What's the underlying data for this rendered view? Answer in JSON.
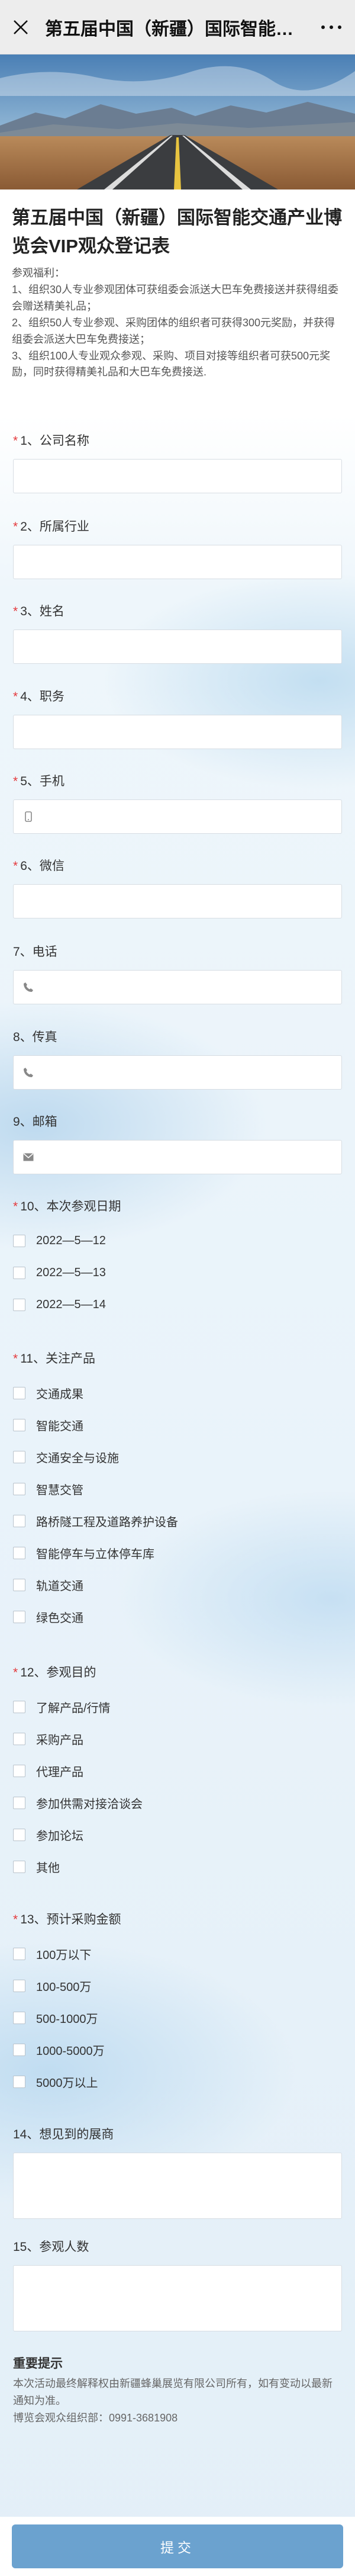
{
  "topbar": {
    "title": "第五届中国（新疆）国际智能交通产..."
  },
  "header": {
    "title": "第五届中国（新疆）国际智能交通产业博览会VIP观众登记表",
    "description": "参观福利：\n1、组织30人专业参观团体可获组委会派送大巴车免费接送并获得组委会赠送精美礼品；\n2、组织50人专业参观、采购团体的组织者可获得300元奖励，并获得组委会派送大巴车免费接送；\n3、组织100人专业观众参观、采购、项目对接等组织者可获500元奖励，同时获得精美礼品和大巴车免费接送."
  },
  "fields": {
    "company": {
      "label": "1、公司名称",
      "required": true
    },
    "industry": {
      "label": "2、所属行业",
      "required": true
    },
    "name": {
      "label": "3、姓名",
      "required": true
    },
    "position": {
      "label": "4、职务",
      "required": true
    },
    "mobile": {
      "label": "5、手机",
      "required": true,
      "icon": "mobile-icon"
    },
    "wechat": {
      "label": "6、微信",
      "required": true
    },
    "phone": {
      "label": "7、电话",
      "required": false,
      "icon": "phone-icon"
    },
    "fax": {
      "label": "8、传真",
      "required": false,
      "icon": "phone-icon"
    },
    "email": {
      "label": "9、邮箱",
      "required": false,
      "icon": "mail-icon"
    },
    "visit_date": {
      "label": "10、本次参观日期",
      "required": true,
      "options": [
        "2022—5—12",
        "2022—5—13",
        "2022—5—14"
      ]
    },
    "products": {
      "label": "11、关注产品",
      "required": true,
      "options": [
        "交通成果",
        "智能交通",
        "交通安全与设施",
        "智慧交管",
        "路桥隧工程及道路养护设备",
        "智能停车与立体停车库",
        "轨道交通",
        "绿色交通"
      ]
    },
    "purpose": {
      "label": "12、参观目的",
      "required": true,
      "options": [
        "了解产品/行情",
        "采购产品",
        "代理产品",
        "参加供需对接洽谈会",
        "参加论坛",
        "其他"
      ]
    },
    "budget": {
      "label": "13、预计采购金额",
      "required": true,
      "options": [
        "100万以下",
        "100-500万",
        "500-1000万",
        "1000-5000万",
        "5000万以上"
      ]
    },
    "booth": {
      "label": "14、想见到的展商",
      "required": false
    },
    "visitors": {
      "label": "15、参观人数",
      "required": false
    }
  },
  "notice": {
    "title": "重要提示",
    "text": "本次活动最终解释权由新疆蜂巢展览有限公司所有，如有变动以最新通知为准。",
    "contact": "博览会观众组织部：0991-3681908"
  },
  "submit_label": "提交",
  "colors": {
    "required": "#e4393c",
    "submit": "#6ba2cf"
  }
}
